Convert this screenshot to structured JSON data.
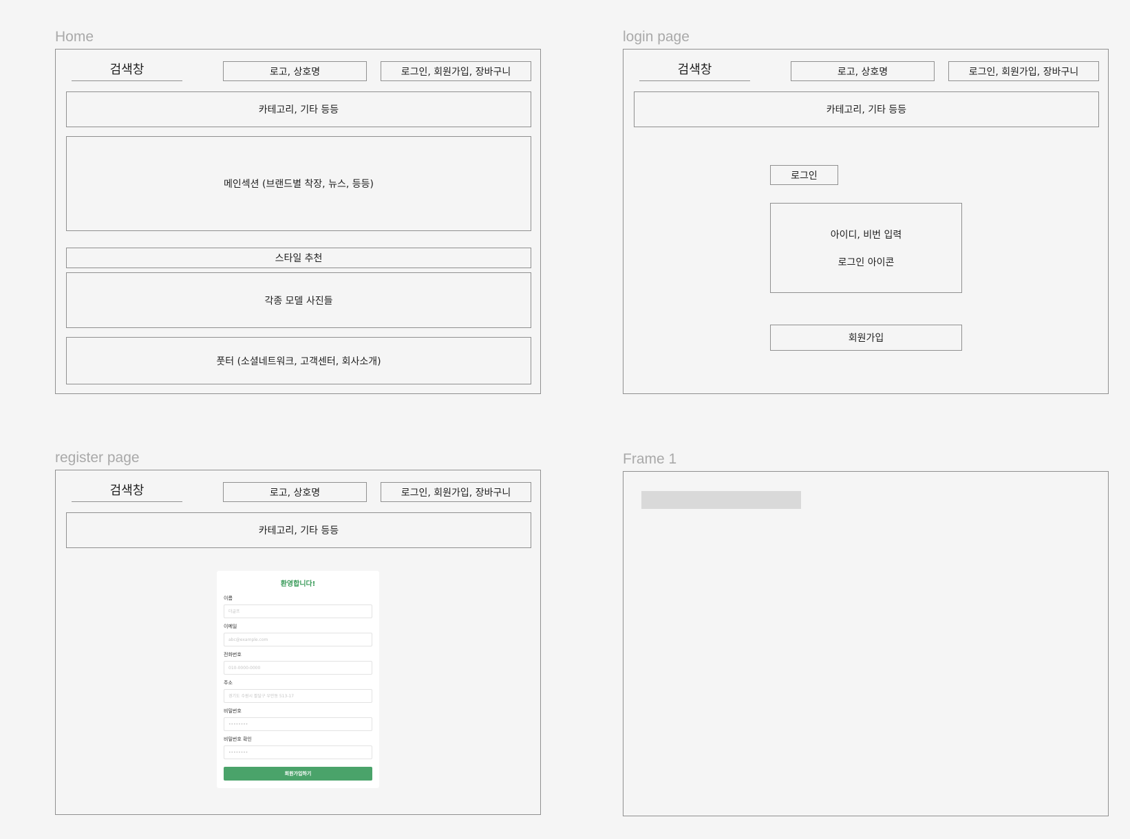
{
  "frames": {
    "home": {
      "label": "Home",
      "search": "검색창",
      "logo": "로고, 상호명",
      "auth": "로그인, 회원가입, 장바구니",
      "category": "카테고리, 기타 등등",
      "main": "메인섹션 (브랜드별 착장, 뉴스, 등등)",
      "style": "스타일 추천",
      "models": "각종 모델 사진들",
      "footer": "풋터 (소셜네트워크, 고객센터, 회사소개)"
    },
    "login": {
      "label": "login page",
      "search": "검색창",
      "logo": "로고, 상호명",
      "auth": "로그인, 회원가입, 장바구니",
      "category": "카테고리, 기타 등등",
      "login_title": "로그인",
      "credentials": "아이디, 비번 입력",
      "login_icon": "로그인 아이콘",
      "signup": "회원가입"
    },
    "register": {
      "label": "register page",
      "search": "검색창",
      "logo": "로고, 상호명",
      "auth": "로그인, 회원가입, 장바구니",
      "category": "카테고리, 기타 등등",
      "form": {
        "title": "환영합니다!",
        "fields": [
          {
            "label": "이름",
            "placeholder": "더글프"
          },
          {
            "label": "이메일",
            "placeholder": "abc@example.com"
          },
          {
            "label": "전화번호",
            "placeholder": "010-0000-0000"
          },
          {
            "label": "주소",
            "placeholder": "경기도 수원시 팔달구 우만동 513-17"
          },
          {
            "label": "비밀번호",
            "placeholder": "••••••••"
          },
          {
            "label": "비밀번호 확인",
            "placeholder": "••••••••"
          }
        ],
        "submit": "회원가입하기"
      }
    },
    "frame1": {
      "label": "Frame 1"
    }
  }
}
